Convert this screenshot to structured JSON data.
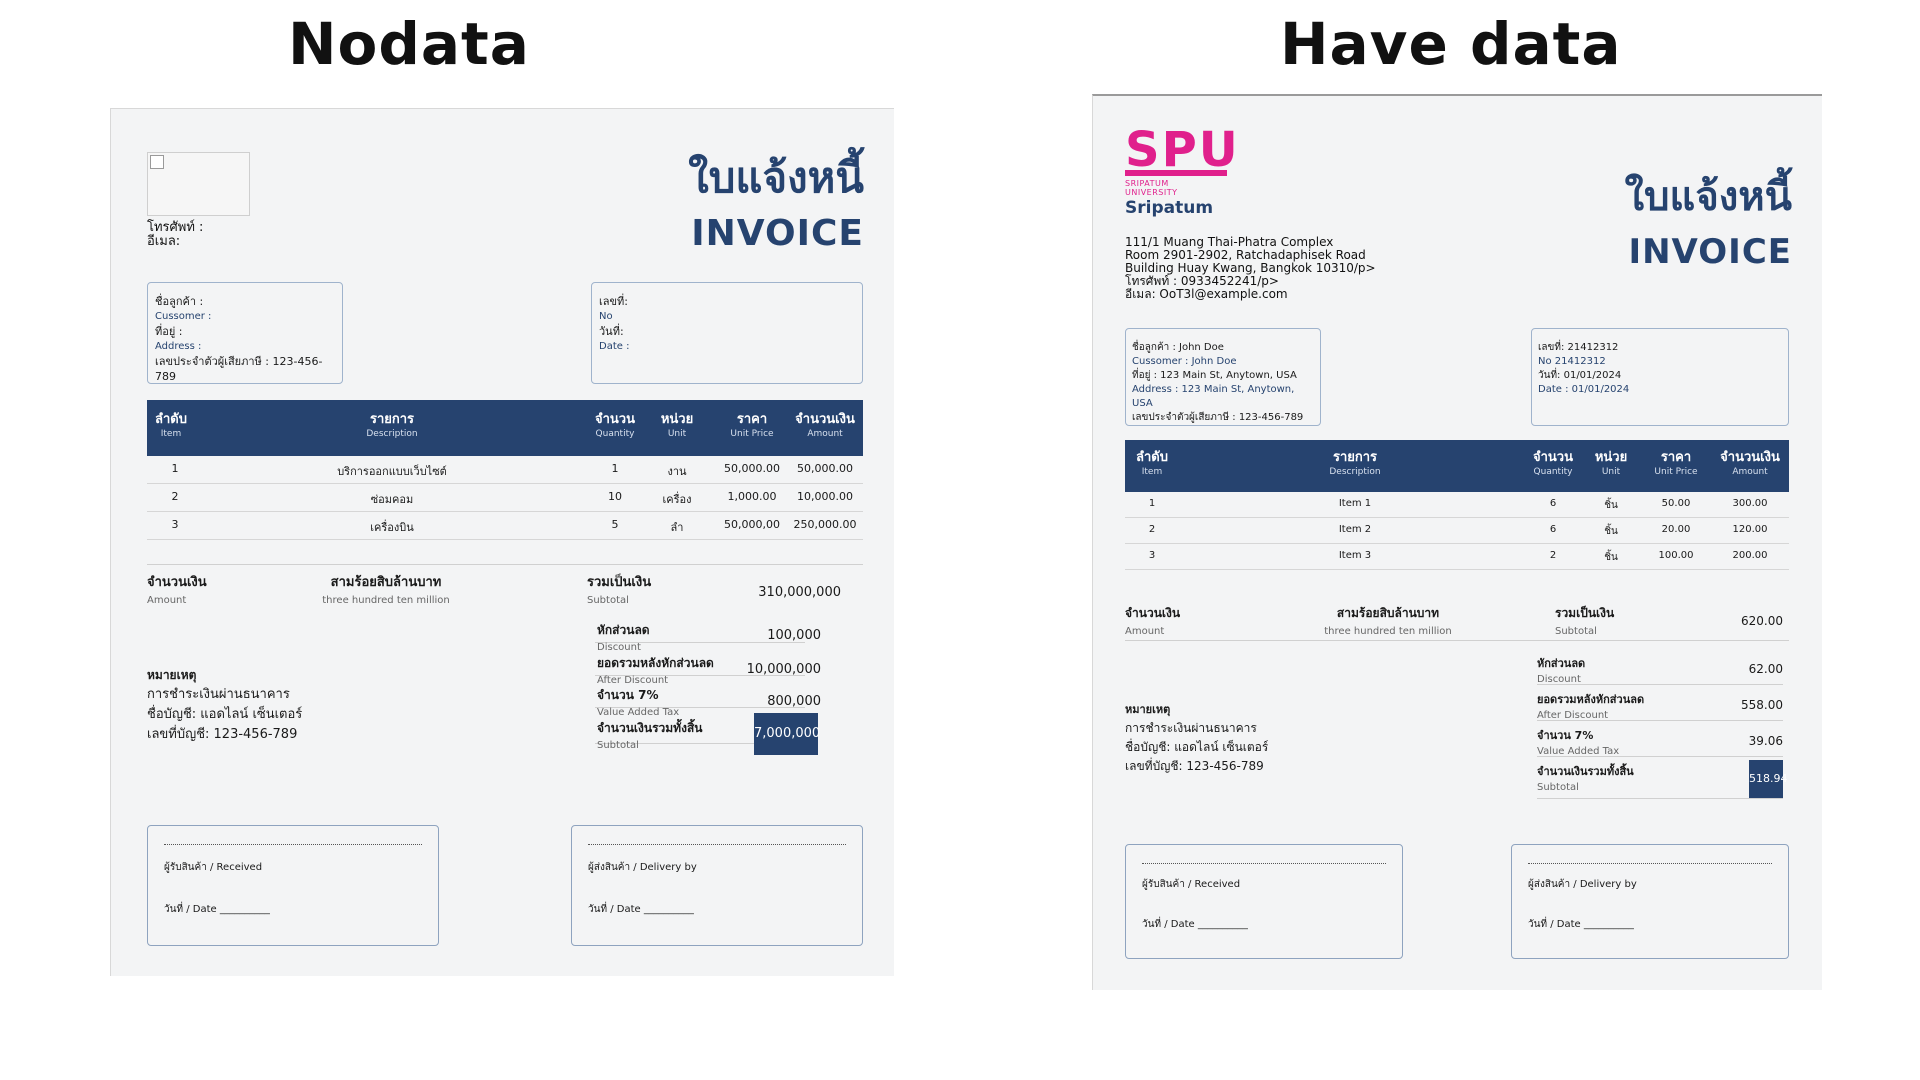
{
  "headings": {
    "left": "Nodata",
    "right": "Have data"
  },
  "left_doc": {
    "contact": {
      "phone_label": "โทรศัพท์ :",
      "email_label": "อีเมล:"
    },
    "title_th": "ใบแจ้งหนี้",
    "title_en": "INVOICE",
    "customer": {
      "name_th": "ชื่อลูกค้า :",
      "name_en": "Cussomer :",
      "addr_th": "ที่อยู่ :",
      "addr_en": "Address :",
      "tax": "เลขประจำตัวผู้เสียภาษี : 123-456-789"
    },
    "docinfo": {
      "no_th": "เลขที่:",
      "no_en": "No",
      "date_th": "วันที่:",
      "date_en": "Date :"
    },
    "columns": [
      {
        "th": "ลำดับ",
        "en": "Item"
      },
      {
        "th": "รายการ",
        "en": "Description"
      },
      {
        "th": "จำนวน",
        "en": "Quantity"
      },
      {
        "th": "หน่วย",
        "en": "Unit"
      },
      {
        "th": "ราคา",
        "en": "Unit Price"
      },
      {
        "th": "จำนวนเงิน",
        "en": "Amount"
      }
    ],
    "rows": [
      {
        "item": "1",
        "desc": "บริการออกแบบเว็บไซต์",
        "qty": "1",
        "unit": "งาน",
        "price": "50,000.00",
        "amount": "50,000.00"
      },
      {
        "item": "2",
        "desc": "ซ่อมคอม",
        "qty": "10",
        "unit": "เครื่อง",
        "price": "1,000.00",
        "amount": "10,000.00"
      },
      {
        "item": "3",
        "desc": "เครื่องบิน",
        "qty": "5",
        "unit": "ลำ",
        "price": "50,000,00",
        "amount": "250,000.00"
      }
    ],
    "amount_th": "จำนวนเงิน",
    "amount_en": "Amount",
    "words_th": "สามร้อยสิบล้านบาท",
    "words_en": "three hundred ten million",
    "totals": [
      {
        "th": "รวมเป็นเงิน",
        "en": "Subtotal",
        "value": "310,000,000"
      },
      {
        "th": "หักส่วนลด",
        "en": "Discount",
        "value": "100,000"
      },
      {
        "th": "ยอดรวมหลังหักส่วนลด",
        "en": "After Discount",
        "value": "10,000,000"
      },
      {
        "th": "จำนวน 7%",
        "en": "Value Added Tax",
        "value": "800,000"
      },
      {
        "th": "จำนวนเงินรวมทั้งสิ้น",
        "en": "Subtotal",
        "value": "7,000,000"
      }
    ],
    "notes": [
      "หมายเหตุ",
      "การชำระเงินผ่านธนาคาร",
      "ชื่อบัญชี: แอดไลน์ เซ็นเตอร์",
      "เลขที่บัญชี: 123-456-789"
    ],
    "sign": {
      "received": "ผู้รับสินค้า / Received",
      "delivery": "ผู้ส่งสินค้า / Delivery by",
      "date": "วันที่ / Date __________"
    }
  },
  "right_doc": {
    "logo": {
      "text": "SPU",
      "line1": "SRIPATUM",
      "line2": "UNIVERSITY"
    },
    "company": "Sripatum",
    "address": [
      "111/1 Muang Thai-Phatra Complex",
      "Room 2901-2902, Ratchadaphisek Road",
      "Building Huay Kwang, Bangkok 10310/p>",
      "โทรศัพท์ : 0933452241/p>",
      "อีเมล: OoT3l@example.com"
    ],
    "title_th": "ใบแจ้งหนี้",
    "title_en": "INVOICE",
    "customer": {
      "name_th": "ชื่อลูกค้า : John Doe",
      "name_en": "Cussomer : John Doe",
      "addr_th": "ที่อยู่ : 123 Main St, Anytown, USA",
      "addr_en": "Address : 123 Main St, Anytown, USA",
      "tax": "เลขประจำตัวผู้เสียภาษี : 123-456-789"
    },
    "docinfo": {
      "no_th": "เลขที่: 21412312",
      "no_en": "No 21412312",
      "date_th": "วันที่: 01/01/2024",
      "date_en": "Date : 01/01/2024"
    },
    "columns": [
      {
        "th": "ลำดับ",
        "en": "Item"
      },
      {
        "th": "รายการ",
        "en": "Description"
      },
      {
        "th": "จำนวน",
        "en": "Quantity"
      },
      {
        "th": "หน่วย",
        "en": "Unit"
      },
      {
        "th": "ราคา",
        "en": "Unit Price"
      },
      {
        "th": "จำนวนเงิน",
        "en": "Amount"
      }
    ],
    "rows": [
      {
        "item": "1",
        "desc": "Item 1",
        "qty": "6",
        "unit": "ชิ้น",
        "price": "50.00",
        "amount": "300.00"
      },
      {
        "item": "2",
        "desc": "Item 2",
        "qty": "6",
        "unit": "ชิ้น",
        "price": "20.00",
        "amount": "120.00"
      },
      {
        "item": "3",
        "desc": "Item 3",
        "qty": "2",
        "unit": "ชิ้น",
        "price": "100.00",
        "amount": "200.00"
      }
    ],
    "amount_th": "จำนวนเงิน",
    "amount_en": "Amount",
    "words_th": "สามร้อยสิบล้านบาท",
    "words_en": "three hundred ten million",
    "totals": [
      {
        "th": "รวมเป็นเงิน",
        "en": "Subtotal",
        "value": "620.00"
      },
      {
        "th": "หักส่วนลด",
        "en": "Discount",
        "value": "62.00"
      },
      {
        "th": "ยอดรวมหลังหักส่วนลด",
        "en": "After Discount",
        "value": "558.00"
      },
      {
        "th": "จำนวน 7%",
        "en": "Value Added Tax",
        "value": "39.06"
      },
      {
        "th": "จำนวนเงินรวมทั้งสิ้น",
        "en": "Subtotal",
        "value": "518.94"
      }
    ],
    "notes": [
      "หมายเหตุ",
      "การชำระเงินผ่านธนาคาร",
      "ชื่อบัญชี: แอดไลน์ เซ็นเตอร์",
      "เลขที่บัญชี: 123-456-789"
    ],
    "sign": {
      "received": "ผู้รับสินค้า / Received",
      "delivery": "ผู้ส่งสินค้า / Delivery by",
      "date": "วันที่ / Date __________"
    }
  },
  "colors": {
    "navy": "#26436f",
    "brand_pink": "#e0208c",
    "paper": "#f3f4f5"
  }
}
